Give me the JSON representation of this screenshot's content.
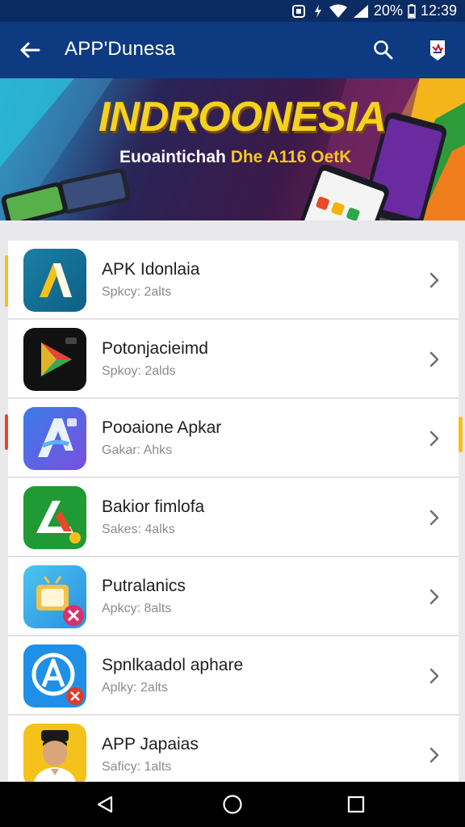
{
  "status_bar": {
    "battery": "20%",
    "time": "12:39"
  },
  "app_bar": {
    "title": "APP'Dunesa"
  },
  "banner": {
    "title": "INDROONESIA",
    "subtitle_prefix": "Euoaintichah ",
    "subtitle_highlight": "Dhe A116  OetK"
  },
  "apps": [
    {
      "name": "APK Idonlaia",
      "sub": "Spkcy: 2alts",
      "icon": "app-icon-yellow-a"
    },
    {
      "name": "Potonjacieimd",
      "sub": "Spkoy: 2alds",
      "icon": "app-icon-play"
    },
    {
      "name": "Pooaione Apkar",
      "sub": "Gakar: Ahks",
      "icon": "app-icon-blue-a"
    },
    {
      "name": "Bakior fimlofa",
      "sub": "Sakes: 4alks",
      "icon": "app-icon-green-a"
    },
    {
      "name": "Putralanics",
      "sub": "Apkcy: 8alts",
      "icon": "app-icon-tv"
    },
    {
      "name": "Spnlkaadol aphare",
      "sub": "Aplky: 2alts",
      "icon": "app-icon-circle-a"
    },
    {
      "name": "APP Japaias",
      "sub": "Saficy: 1alts",
      "icon": "app-icon-person"
    }
  ],
  "colors": {
    "status_bar": "#0b2b63",
    "app_bar": "#0d3a80",
    "banner_title": "#f5d21f",
    "nav_bar": "#000000"
  }
}
